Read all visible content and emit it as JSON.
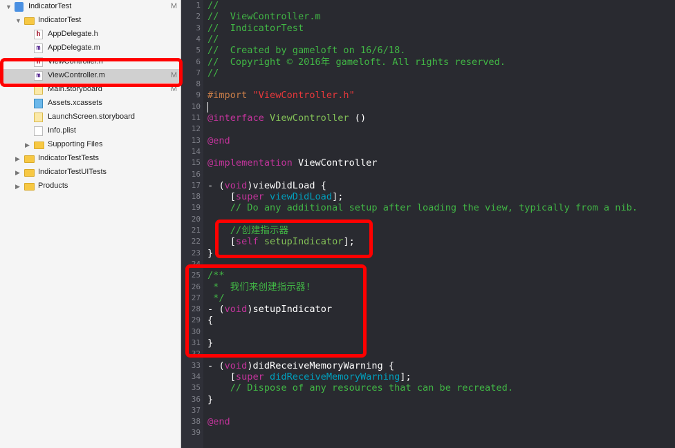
{
  "navigator": {
    "items": [
      {
        "label": "IndicatorTest",
        "icon": "project-icon",
        "indent": 0,
        "disclosure": "open",
        "badge": "M"
      },
      {
        "label": "IndicatorTest",
        "icon": "folder-icon",
        "indent": 1,
        "disclosure": "open",
        "badge": ""
      },
      {
        "label": "AppDelegate.h",
        "icon": "header-file-icon",
        "indent": 2,
        "disclosure": "",
        "badge": ""
      },
      {
        "label": "AppDelegate.m",
        "icon": "objc-file-icon",
        "indent": 2,
        "disclosure": "",
        "badge": ""
      },
      {
        "label": "ViewController.h",
        "icon": "header-file-icon",
        "indent": 2,
        "disclosure": "",
        "badge": ""
      },
      {
        "label": "ViewController.m",
        "icon": "objc-file-icon",
        "indent": 2,
        "disclosure": "",
        "badge": "M",
        "selected": true
      },
      {
        "label": "Main.storyboard",
        "icon": "storyboard-icon",
        "indent": 2,
        "disclosure": "",
        "badge": "M"
      },
      {
        "label": "Assets.xcassets",
        "icon": "assets-icon",
        "indent": 2,
        "disclosure": "",
        "badge": ""
      },
      {
        "label": "LaunchScreen.storyboard",
        "icon": "storyboard-icon",
        "indent": 2,
        "disclosure": "",
        "badge": ""
      },
      {
        "label": "Info.plist",
        "icon": "plist-icon",
        "indent": 2,
        "disclosure": "",
        "badge": ""
      },
      {
        "label": "Supporting Files",
        "icon": "folder-icon",
        "indent": 2,
        "disclosure": "closed",
        "badge": ""
      },
      {
        "label": "IndicatorTestTests",
        "icon": "folder-icon",
        "indent": 1,
        "disclosure": "closed",
        "badge": ""
      },
      {
        "label": "IndicatorTestUITests",
        "icon": "folder-icon",
        "indent": 1,
        "disclosure": "closed",
        "badge": ""
      },
      {
        "label": "Products",
        "icon": "folder-icon",
        "indent": 1,
        "disclosure": "closed",
        "badge": ""
      }
    ]
  },
  "editor": {
    "lines": [
      [
        [
          "//",
          "c"
        ]
      ],
      [
        [
          "//  ViewController.m",
          "c"
        ]
      ],
      [
        [
          "//  IndicatorTest",
          "c"
        ]
      ],
      [
        [
          "//",
          "c"
        ]
      ],
      [
        [
          "//  Created by gameloft on 16/6/18.",
          "c"
        ]
      ],
      [
        [
          "//  Copyright © 2016年 gameloft. All rights reserved.",
          "c"
        ]
      ],
      [
        [
          "//",
          "c"
        ]
      ],
      [],
      [
        [
          "#import ",
          "p"
        ],
        [
          "\"ViewController.h\"",
          "s"
        ]
      ],
      [],
      [
        [
          "@interface",
          "k"
        ],
        [
          " ViewController",
          "t"
        ],
        [
          " ()",
          "d"
        ]
      ],
      [],
      [
        [
          "@end",
          "k"
        ]
      ],
      [],
      [
        [
          "@implementation",
          "k"
        ],
        [
          " ViewController",
          "d"
        ]
      ],
      [],
      [
        [
          "- (",
          "d"
        ],
        [
          "void",
          "k"
        ],
        [
          ")viewDidLoad {",
          "d"
        ]
      ],
      [
        [
          "    [",
          "d"
        ],
        [
          "super",
          "k"
        ],
        [
          " viewDidLoad",
          "m"
        ],
        [
          "];",
          "d"
        ]
      ],
      [
        [
          "    // Do any additional setup after loading the view, typically from a nib.",
          "c"
        ]
      ],
      [],
      [
        [
          "    //创建指示器",
          "c"
        ]
      ],
      [
        [
          "    [",
          "d"
        ],
        [
          "self",
          "k"
        ],
        [
          " setupIndicator",
          "t"
        ],
        [
          "];",
          "d"
        ]
      ],
      [
        [
          "}",
          "d"
        ]
      ],
      [],
      [
        [
          "/**",
          "c"
        ]
      ],
      [
        [
          " *  我们来创建指示器!",
          "c"
        ]
      ],
      [
        [
          " */",
          "c"
        ]
      ],
      [
        [
          "- (",
          "d"
        ],
        [
          "void",
          "k"
        ],
        [
          ")setupIndicator",
          "d"
        ]
      ],
      [
        [
          "{",
          "d"
        ]
      ],
      [],
      [
        [
          "}",
          "d"
        ]
      ],
      [],
      [
        [
          "- (",
          "d"
        ],
        [
          "void",
          "k"
        ],
        [
          ")didReceiveMemoryWarning {",
          "d"
        ]
      ],
      [
        [
          "    [",
          "d"
        ],
        [
          "super",
          "k"
        ],
        [
          " didReceiveMemoryWarning",
          "m"
        ],
        [
          "];",
          "d"
        ]
      ],
      [
        [
          "    // Dispose of any resources that can be recreated.",
          "c"
        ]
      ],
      [
        [
          "}",
          "d"
        ]
      ],
      [],
      [
        [
          "@end",
          "k"
        ]
      ],
      []
    ]
  },
  "colors": {
    "highlight_box": "#ff0000",
    "comment": "#41b645",
    "keyword": "#c2349b",
    "string": "#e5383b"
  }
}
